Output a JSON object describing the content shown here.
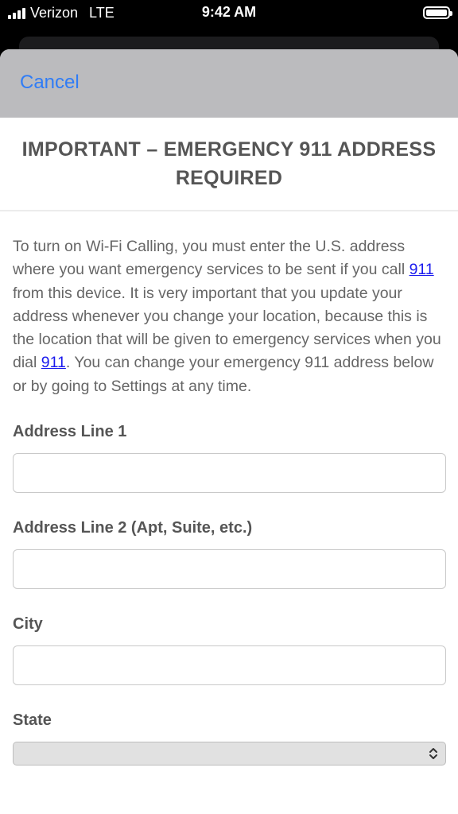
{
  "status_bar": {
    "carrier": "Verizon",
    "network": "LTE",
    "time": "9:42 AM"
  },
  "sheet": {
    "cancel_label": "Cancel",
    "title": "IMPORTANT – EMERGENCY 911 ADDRESS REQUIRED",
    "paragraph": {
      "part1": "To turn on Wi-Fi Calling, you must enter the U.S. address where you want emergency services to be sent if you call ",
      "link1": "911",
      "part2": " from this device. It is very important that you update your address whenever you change your location, because this is the location that will be given to emergency services when you dial ",
      "link2": "911",
      "part3": ". You can change your emergency 911 address below or by going to Settings at any time."
    },
    "fields": {
      "address1_label": "Address Line 1",
      "address1_value": "",
      "address2_label": "Address Line 2 (Apt, Suite, etc.)",
      "address2_value": "",
      "city_label": "City",
      "city_value": "",
      "state_label": "State",
      "state_value": ""
    }
  },
  "icons": {
    "signal": "signal-bars-icon",
    "battery": "battery-icon",
    "select_arrows": "chevron-up-down-icon"
  },
  "colors": {
    "link": "#2f7cf6",
    "header_bg": "#bbbbbe",
    "anchor": "#1a1aee"
  }
}
